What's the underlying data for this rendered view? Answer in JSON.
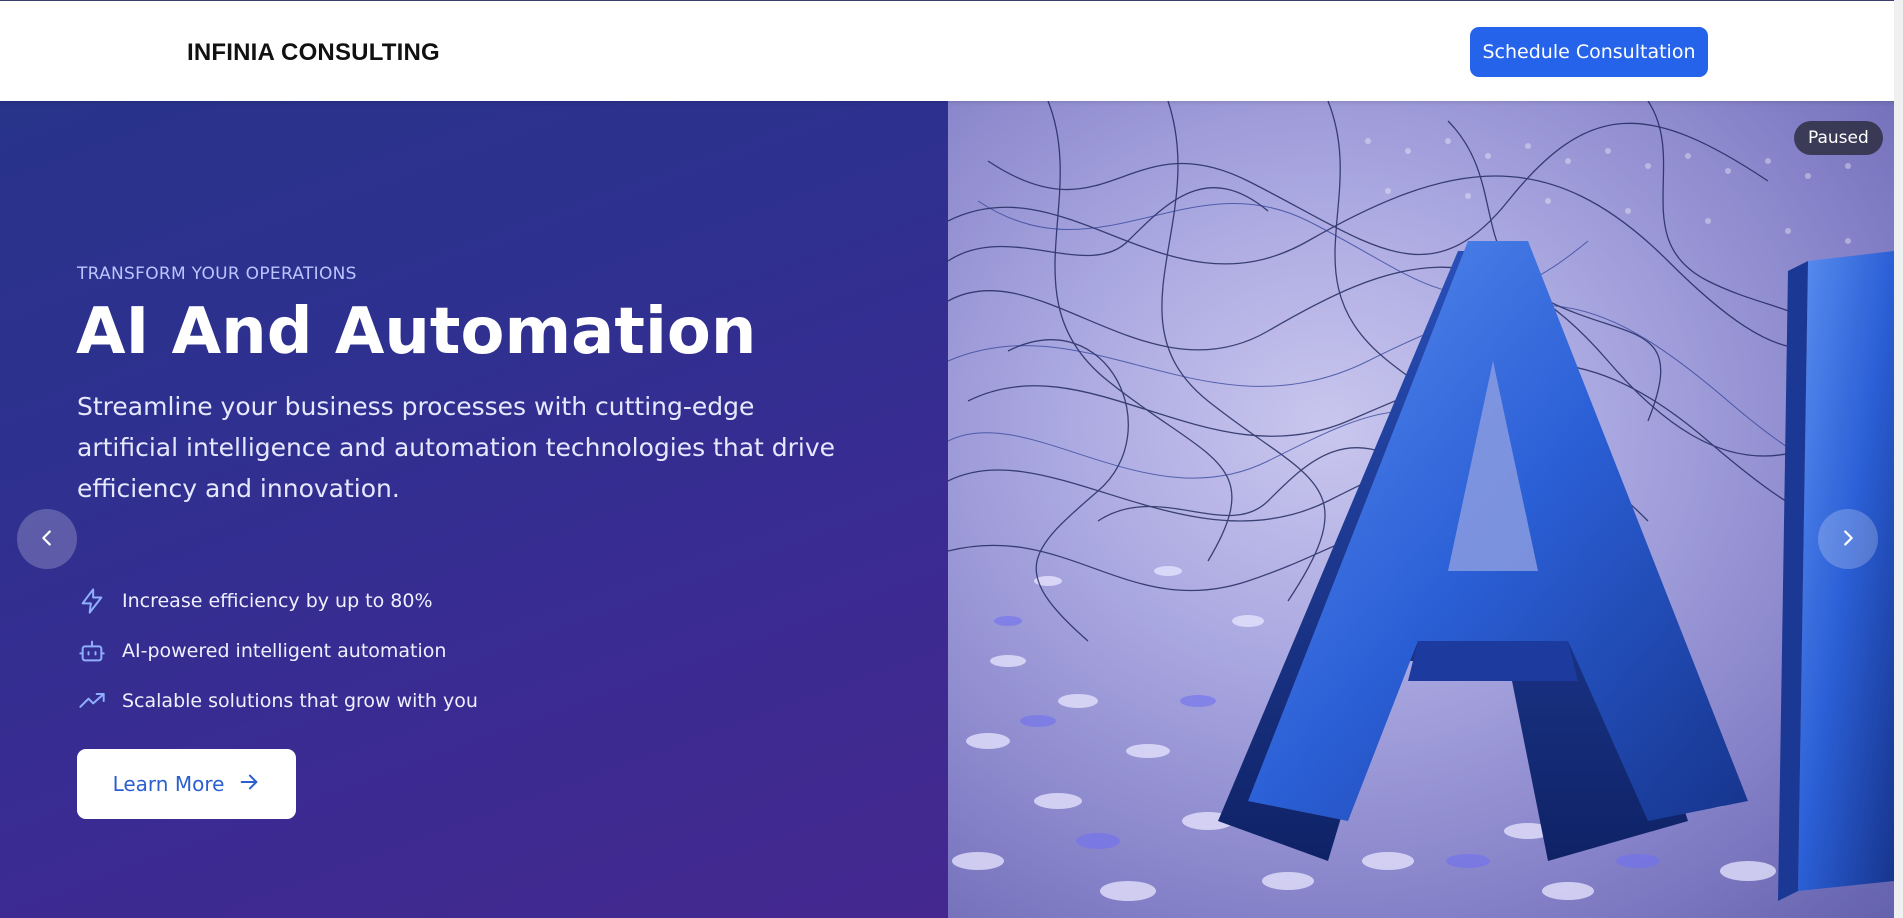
{
  "header": {
    "brand": "INFINIA CONSULTING",
    "cta_label": "Schedule Consultation"
  },
  "hero": {
    "eyebrow": "TRANSFORM YOUR OPERATIONS",
    "title": "AI And Automation",
    "description": "Streamline your business processes with cutting-edge artificial intelligence and automation technologies that drive efficiency and innovation.",
    "features": [
      {
        "icon": "lightning-icon",
        "text": "Increase efficiency by up to 80%"
      },
      {
        "icon": "robot-icon",
        "text": "AI-powered intelligent automation"
      },
      {
        "icon": "trending-up-icon",
        "text": "Scalable solutions that grow with you"
      }
    ],
    "learn_more_label": "Learn More",
    "slideshow_status": "Paused"
  },
  "colors": {
    "accent": "#2563eb",
    "hero_gradient_start": "#28338a",
    "hero_gradient_end": "#44288f",
    "eyebrow": "#b9c6ff"
  }
}
